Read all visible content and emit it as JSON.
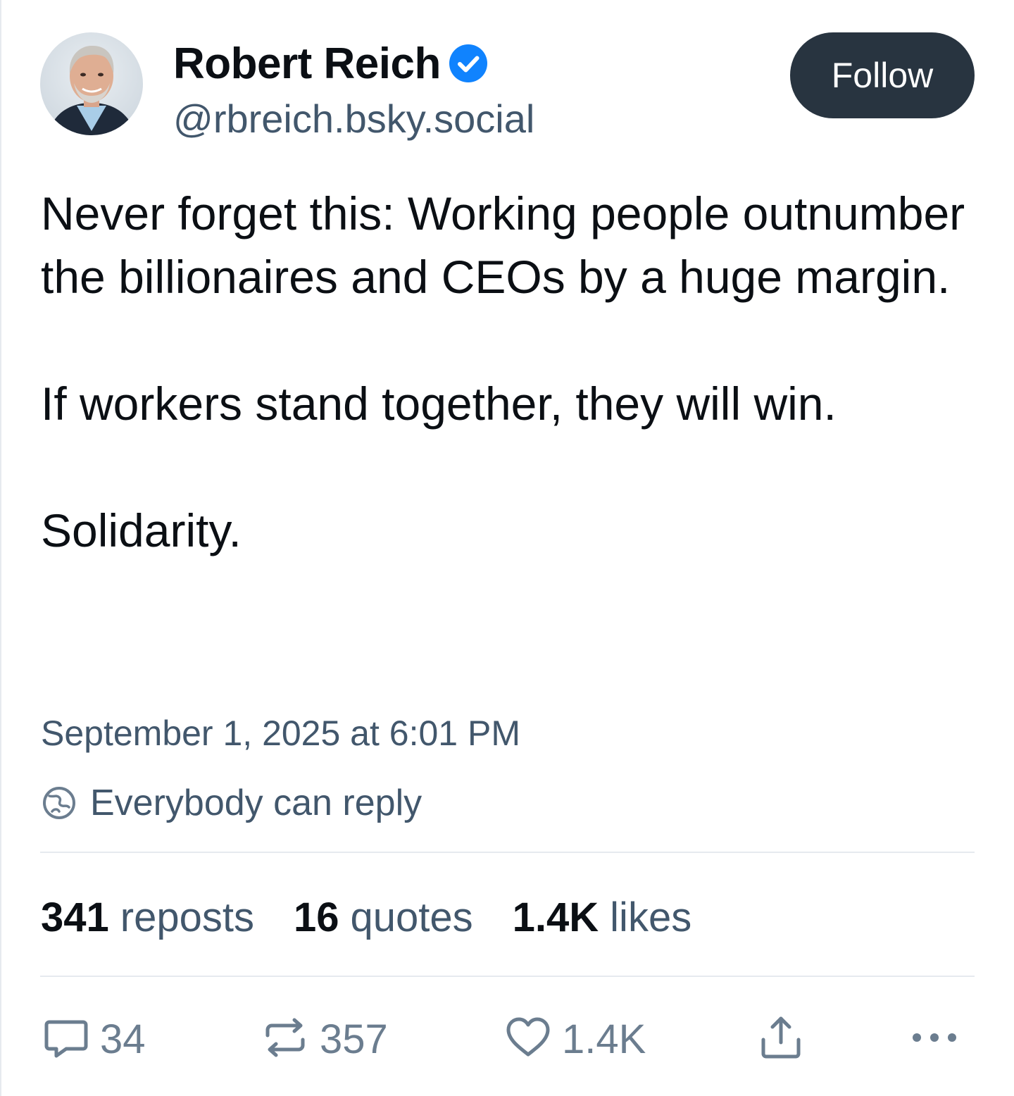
{
  "author": {
    "display_name": "Robert Reich",
    "handle": "@rbreich.bsky.social",
    "verified": true,
    "verified_color": "#1083fe"
  },
  "header": {
    "follow_label": "Follow"
  },
  "post": {
    "paragraphs": [
      "Never forget this: Working people outnumber the billionaires and CEOs by a huge margin.",
      "If workers stand together, they will win.",
      "Solidarity."
    ],
    "timestamp": "September 1, 2025 at 6:01 PM",
    "reply_setting": "Everybody can reply"
  },
  "stats": {
    "reposts_count": "341",
    "reposts_label": "reposts",
    "quotes_count": "16",
    "quotes_label": "quotes",
    "likes_count": "1.4K",
    "likes_label": "likes"
  },
  "actions": {
    "reply_count": "34",
    "repost_count": "357",
    "like_count": "1.4K"
  },
  "colors": {
    "text_primary": "#0b0f14",
    "text_secondary": "#42576c",
    "icon_muted": "#6b7d8f",
    "follow_button_bg": "#283440",
    "divider": "#e6eaef"
  }
}
